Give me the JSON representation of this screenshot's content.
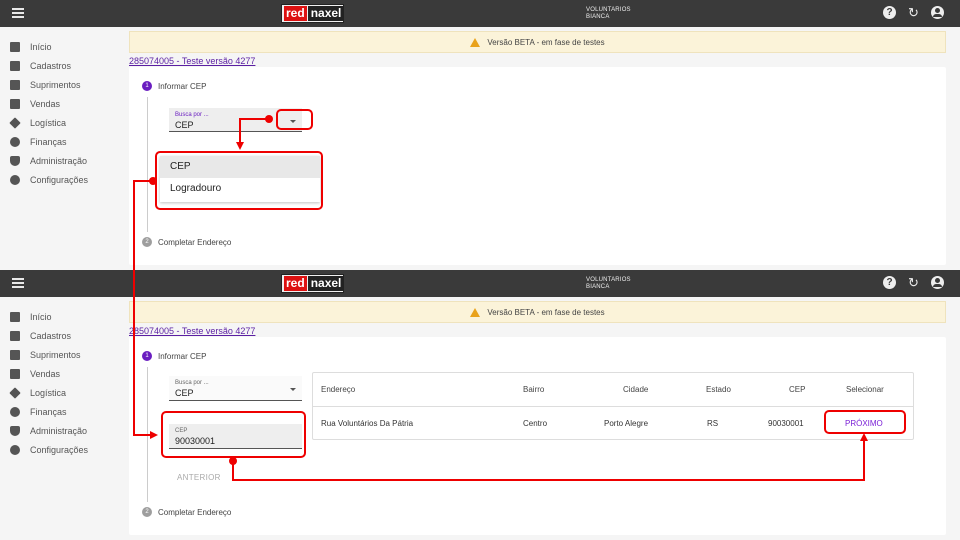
{
  "app": {
    "logo_red": "red",
    "logo_dark": "naxel",
    "user_line1": "VOLUNTARIOS",
    "user_line2": "BIANCA",
    "icons": [
      "menu-icon",
      "help-icon",
      "refresh-icon",
      "account-icon"
    ]
  },
  "sidebar": {
    "items": [
      {
        "label": "Início",
        "icon": "home-icon"
      },
      {
        "label": "Cadastros",
        "icon": "folder-icon"
      },
      {
        "label": "Suprimentos",
        "icon": "briefcase-icon"
      },
      {
        "label": "Vendas",
        "icon": "cart-icon"
      },
      {
        "label": "Logística",
        "icon": "diamond-icon"
      },
      {
        "label": "Finanças",
        "icon": "dollar-icon"
      },
      {
        "label": "Administração",
        "icon": "shield-icon"
      },
      {
        "label": "Configurações",
        "icon": "gear-icon"
      }
    ]
  },
  "banner": {
    "text": "Versão BETA - em fase de testes"
  },
  "record_link": "285074005 - Teste versão 4277",
  "steps": [
    {
      "num": "1",
      "label": "Informar CEP"
    },
    {
      "num": "2",
      "label": "Completar Endereço"
    }
  ],
  "search_by": {
    "label": "Busca por ...",
    "value": "CEP"
  },
  "dropdown": {
    "options": [
      "CEP",
      "Logradouro"
    ]
  },
  "cep_field": {
    "label": "CEP",
    "value": "90030001"
  },
  "anterior_label": "ANTERIOR",
  "table": {
    "headers": [
      "Endereço",
      "Bairro",
      "Cidade",
      "Estado",
      "CEP",
      "Selecionar"
    ],
    "rows": [
      {
        "endereco": "Rua Voluntários Da Pátria",
        "bairro": "Centro",
        "cidade": "Porto Alegre",
        "estado": "RS",
        "cep": "90030001",
        "action": "PRÓXIMO"
      }
    ]
  },
  "colors": {
    "topbar": "#3a3a3a",
    "accent": "#6a1ec0",
    "highlight": "#e00000",
    "banner": "#fbf3d9"
  }
}
